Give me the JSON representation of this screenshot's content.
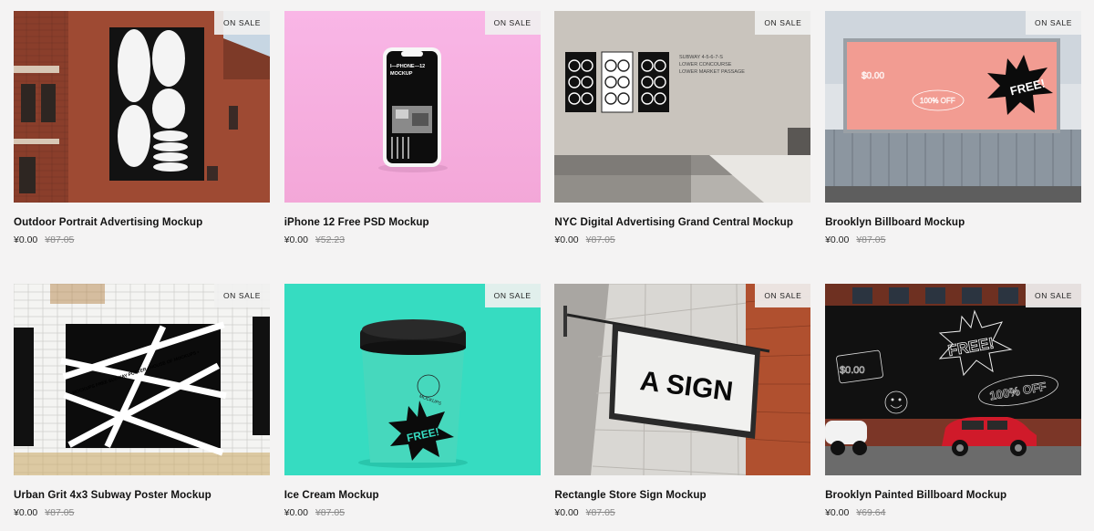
{
  "products": [
    {
      "title": "Outdoor Portrait Advertising Mockup",
      "price": "¥0.00",
      "old_price": "¥87.05",
      "badge": "ON SALE"
    },
    {
      "title": "iPhone 12 Free PSD Mockup",
      "price": "¥0.00",
      "old_price": "¥52.23",
      "badge": "ON SALE",
      "screen_text": [
        "I—PHONE—12",
        "MOCKUP"
      ]
    },
    {
      "title": "NYC Digital Advertising Grand Central Mockup",
      "price": "¥0.00",
      "old_price": "¥87.05",
      "badge": "ON SALE",
      "sign_text": [
        "SUBWAY 4-5-6-7-S",
        "LOWER CONCOURSE",
        "LOWER MARKET PASSAGE"
      ]
    },
    {
      "title": "Brooklyn Billboard Mockup",
      "price": "¥0.00",
      "old_price": "¥87.05",
      "badge": "ON SALE",
      "art_text": [
        "FREE!",
        "$0.00",
        "100% OFF"
      ]
    },
    {
      "title": "Urban Grit 4x3 Subway Poster Mockup",
      "price": "¥0.00",
      "old_price": "¥87.05",
      "badge": "ON SALE",
      "tape_text": "MOCKUPS FREE SUBWAY POSTER • HOUSE OF MOCKUPS •"
    },
    {
      "title": "Ice Cream Mockup",
      "price": "¥0.00",
      "old_price": "¥87.05",
      "badge": "ON SALE",
      "art_text": [
        "FREE!",
        "MOCKUPS"
      ]
    },
    {
      "title": "Rectangle Store Sign Mockup",
      "price": "¥0.00",
      "old_price": "¥87.05",
      "badge": "ON SALE",
      "sign_text": "A SIGN"
    },
    {
      "title": "Brooklyn Painted Billboard Mockup",
      "price": "¥0.00",
      "old_price": "¥69.64",
      "badge": "ON SALE",
      "art_text": [
        "FREE!",
        "$0.00",
        "100% OFF"
      ]
    }
  ]
}
